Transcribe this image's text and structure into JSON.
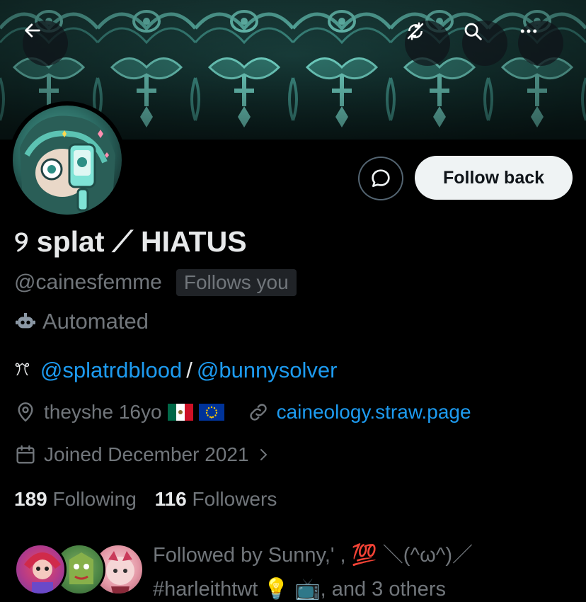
{
  "header": {
    "back_icon": "arrow-left-icon",
    "sync_icon": "sync-off-icon",
    "search_icon": "search-icon",
    "more_icon": "more-horizontal-icon"
  },
  "colors": {
    "background": "#000000",
    "link": "#1d9bf0",
    "muted": "#71767b",
    "text": "#e7e9ea",
    "banner": "#1d4643"
  },
  "profile": {
    "display_name": "୨ splat ⟋ HIATUS",
    "handle": "@cainesfemme",
    "follows_you": "Follows you",
    "automated_label": "Automated",
    "bio": {
      "glyph": "ꔫ",
      "link1": "@splatrdblood",
      "separator": "/",
      "link2": "@bunnysolver"
    },
    "location": "theyshe 16yo",
    "website": "caineology.straw.page",
    "joined": "Joined December 2021",
    "following_count": "189",
    "following_label": "Following",
    "followers_count": "116",
    "followers_label": "Followers",
    "followed_by_line1": "Followed by Sunny,' , 💯 ＼(^ω^)／",
    "followed_by_line2": "#harleithtwt 💡 📺, and 3 others"
  },
  "actions": {
    "follow_back": "Follow back",
    "dm_icon": "message-icon"
  }
}
